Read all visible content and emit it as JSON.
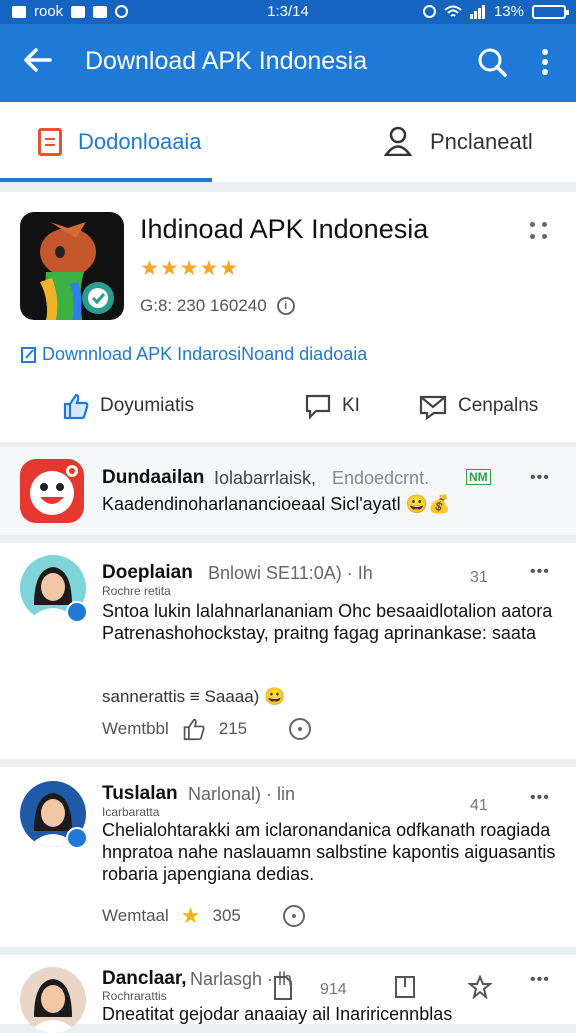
{
  "status_bar": {
    "left_text": "rook",
    "time": "1:3/14",
    "battery": "13%"
  },
  "app_bar": {
    "title": "Download APK Indonesia"
  },
  "tabs": [
    {
      "label": "Dodonloaaia",
      "active": true
    },
    {
      "label": "Pnclaneatl",
      "active": false
    }
  ],
  "app_card": {
    "title": "Ihdinoad APK Indonesia",
    "stars": "★★★★★",
    "meta": "G:8: 230 160240",
    "link": "Downnload APK IndarosiNoand diadoaia",
    "actions": [
      {
        "label": "Doyumiatis",
        "icon": "thumbs-up-icon"
      },
      {
        "label": "KI",
        "icon": "comment-icon"
      },
      {
        "label": "Cenpalns",
        "icon": "share-icon"
      }
    ]
  },
  "notification": {
    "name": "Dundaailan",
    "sub1": "Iolabarrlaisk,",
    "sub2": "Endoedcrnt.",
    "badge": "NM",
    "text": "Kaadendinoharlanancioeaal Sicl'ayatl 😀💰"
  },
  "posts": [
    {
      "name": "Doeplaian",
      "sub": "Bnlowi SE11:0A) · Ih",
      "small": "Rochre retita",
      "count": "31",
      "text": "Sntoa lukin lalahnarlananiam Ohc besaaidlotalion aatora Patrenashohockstay, praitng fagag aprinankase: saata",
      "tag": "sannerattis ≡ Saaaa) 😀",
      "foot_label": "Wemtbbl",
      "foot_count": "215"
    },
    {
      "name": "Tuslalan",
      "sub": "Narlonal) · lin",
      "small": "Icarbaratta",
      "count": "41",
      "text": "Chelialohtarakki am iclaronandanica odfkanath roagiada hnpratoa nahe naslauamn salbstine kapontis aiguasantis robaria japengiana dedias.",
      "foot_label": "Wemtaal",
      "foot_count": "305"
    },
    {
      "name": "Danclaar,",
      "sub": "Narlasgh · lh",
      "small": "Rochrarattis",
      "count": "914",
      "text": "Dneatitat gejodar anaaiay ail Inariricennblas"
    }
  ],
  "more_label": "•••"
}
